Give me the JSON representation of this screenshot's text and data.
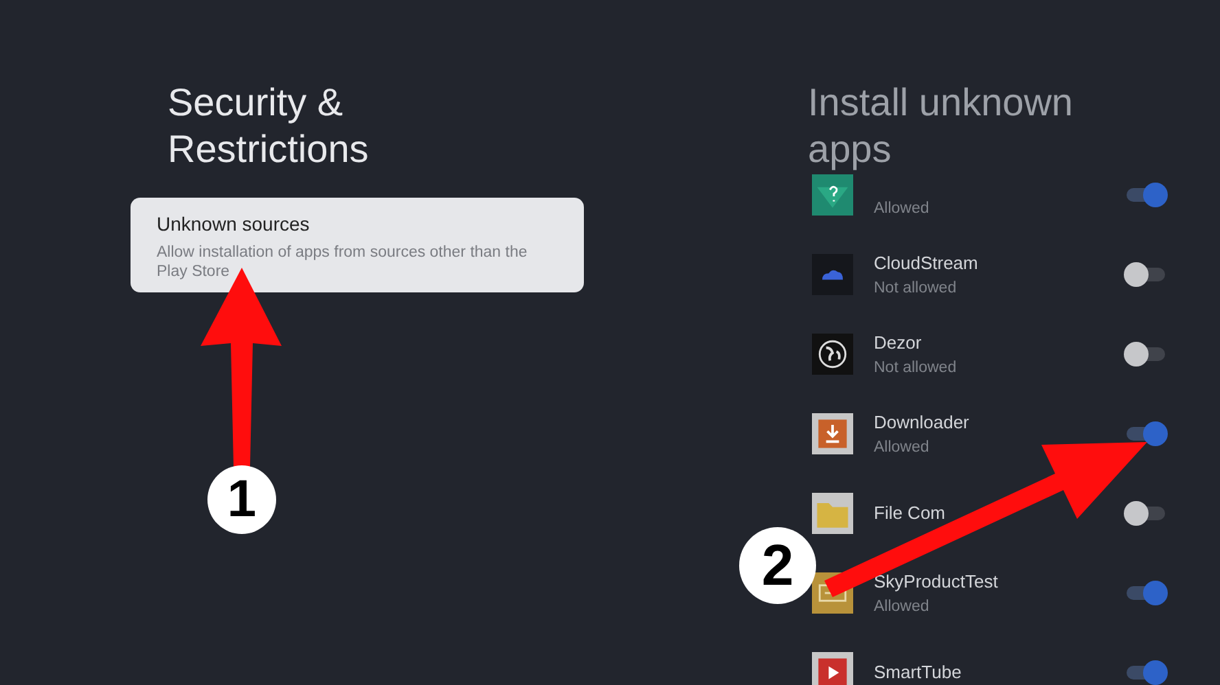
{
  "left": {
    "title": "Security & Restrictions",
    "option": {
      "title": "Unknown sources",
      "description": "Allow installation of apps from sources other than the Play Store",
      "selected": true
    }
  },
  "right": {
    "title": "Install unknown apps",
    "apps": [
      {
        "status": "Allowed",
        "on": true
      },
      {
        "name": "CloudStream",
        "status": "Not allowed",
        "on": false
      },
      {
        "name": "Dezor",
        "status": "Not allowed",
        "on": false
      },
      {
        "name": "Downloader",
        "status": "Allowed",
        "on": true
      },
      {
        "name": "File Com",
        "on": false
      },
      {
        "name": "SkyProductTest",
        "status": "Allowed",
        "on": true
      },
      {
        "name": "SmartTube",
        "on": true
      }
    ]
  },
  "annotations": [
    {
      "label": "1"
    },
    {
      "label": "2"
    }
  ]
}
